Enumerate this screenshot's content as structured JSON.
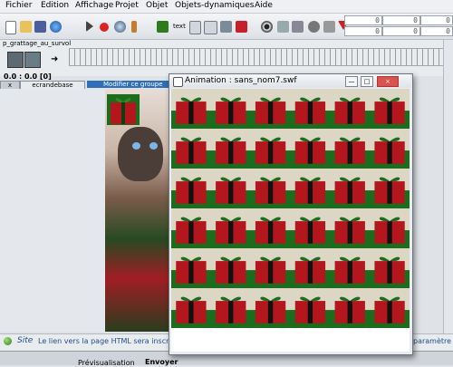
{
  "menubar": {
    "items": [
      "Fichier",
      "Edition",
      "Affichage",
      "Projet",
      "Objet",
      "Objets-dynamiques",
      "Aide"
    ]
  },
  "toolbar": {
    "text_button_label": "text",
    "coords": [
      "0",
      "0",
      "0",
      "0",
      "0",
      "0"
    ]
  },
  "timeline": {
    "scene_name": "p_grattage_au_survol",
    "frame_label": "0.0 : 0.0 [0]"
  },
  "tabs": {
    "close_label": "x",
    "main_label": "ecrandebase",
    "modify_label": "Modifier ce groupe"
  },
  "animation_window": {
    "title": "Animation : sans_nom7.swf",
    "minimize_label": "—",
    "maximize_label": "□",
    "close_label": "×",
    "grid_rows": 6,
    "grid_cols": 6
  },
  "status": {
    "site_label": "Site",
    "message": "Le lien vers la page HTML sera inscrit ici",
    "right_text": "paramètre"
  },
  "bottom_tabs": {
    "preview_label": "Prévisualisation",
    "send_label": "Envoyer"
  },
  "colors": {
    "gift_red": "#b3161c",
    "ribbon_green": "#1f6a1c",
    "stripe_beige": "#dcd6c5",
    "stripe_green": "#1b6c1d"
  },
  "icons": [
    "new-file-icon",
    "open-folder-icon",
    "save-icon",
    "globe-icon",
    "play-icon",
    "record-icon",
    "zoom-icon",
    "tree-icon",
    "image-icon",
    "gift-icon",
    "eye-icon",
    "triangle-icon"
  ]
}
